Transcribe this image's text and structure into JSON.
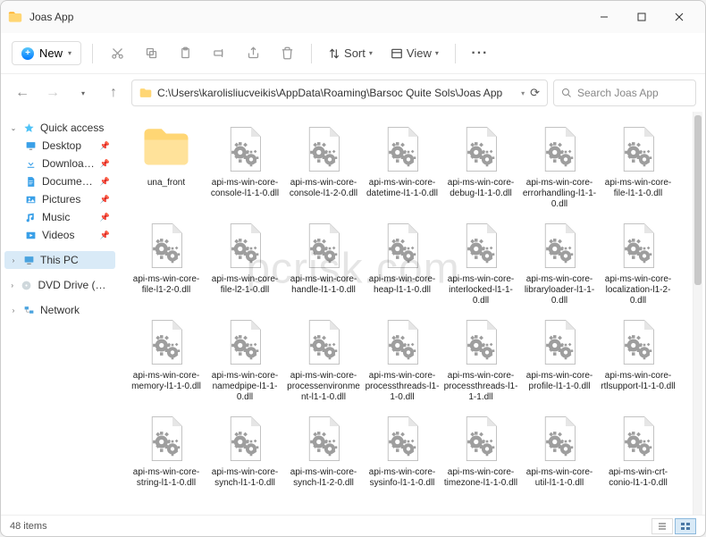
{
  "title": "Joas App",
  "toolbar": {
    "new_label": "New",
    "sort_label": "Sort",
    "view_label": "View"
  },
  "address": {
    "path": "C:\\Users\\karolisliucveikis\\AppData\\Roaming\\Barsoc Quite Sols\\Joas App",
    "search_placeholder": "Search Joas App"
  },
  "sidebar": {
    "quick_access": "Quick access",
    "items": [
      {
        "label": "Desktop",
        "icon": "desktop"
      },
      {
        "label": "Downloads",
        "icon": "downloads"
      },
      {
        "label": "Documents",
        "icon": "documents"
      },
      {
        "label": "Pictures",
        "icon": "pictures"
      },
      {
        "label": "Music",
        "icon": "music"
      },
      {
        "label": "Videos",
        "icon": "videos"
      }
    ],
    "this_pc": "This PC",
    "dvd": "DVD Drive (D:) CCCC",
    "network": "Network"
  },
  "files": [
    {
      "name": "una_front",
      "type": "folder"
    },
    {
      "name": "api-ms-win-core-console-l1-1-0.dll",
      "type": "dll"
    },
    {
      "name": "api-ms-win-core-console-l1-2-0.dll",
      "type": "dll"
    },
    {
      "name": "api-ms-win-core-datetime-l1-1-0.dll",
      "type": "dll"
    },
    {
      "name": "api-ms-win-core-debug-l1-1-0.dll",
      "type": "dll"
    },
    {
      "name": "api-ms-win-core-errorhandling-l1-1-0.dll",
      "type": "dll"
    },
    {
      "name": "api-ms-win-core-file-l1-1-0.dll",
      "type": "dll"
    },
    {
      "name": "api-ms-win-core-file-l1-2-0.dll",
      "type": "dll"
    },
    {
      "name": "api-ms-win-core-file-l2-1-0.dll",
      "type": "dll"
    },
    {
      "name": "api-ms-win-core-handle-l1-1-0.dll",
      "type": "dll"
    },
    {
      "name": "api-ms-win-core-heap-l1-1-0.dll",
      "type": "dll"
    },
    {
      "name": "api-ms-win-core-interlocked-l1-1-0.dll",
      "type": "dll"
    },
    {
      "name": "api-ms-win-core-libraryloader-l1-1-0.dll",
      "type": "dll"
    },
    {
      "name": "api-ms-win-core-localization-l1-2-0.dll",
      "type": "dll"
    },
    {
      "name": "api-ms-win-core-memory-l1-1-0.dll",
      "type": "dll"
    },
    {
      "name": "api-ms-win-core-namedpipe-l1-1-0.dll",
      "type": "dll"
    },
    {
      "name": "api-ms-win-core-processenvironment-l1-1-0.dll",
      "type": "dll"
    },
    {
      "name": "api-ms-win-core-processthreads-l1-1-0.dll",
      "type": "dll"
    },
    {
      "name": "api-ms-win-core-processthreads-l1-1-1.dll",
      "type": "dll"
    },
    {
      "name": "api-ms-win-core-profile-l1-1-0.dll",
      "type": "dll"
    },
    {
      "name": "api-ms-win-core-rtlsupport-l1-1-0.dll",
      "type": "dll"
    },
    {
      "name": "api-ms-win-core-string-l1-1-0.dll",
      "type": "dll"
    },
    {
      "name": "api-ms-win-core-synch-l1-1-0.dll",
      "type": "dll"
    },
    {
      "name": "api-ms-win-core-synch-l1-2-0.dll",
      "type": "dll"
    },
    {
      "name": "api-ms-win-core-sysinfo-l1-1-0.dll",
      "type": "dll"
    },
    {
      "name": "api-ms-win-core-timezone-l1-1-0.dll",
      "type": "dll"
    },
    {
      "name": "api-ms-win-core-util-l1-1-0.dll",
      "type": "dll"
    },
    {
      "name": "api-ms-win-crt-conio-l1-1-0.dll",
      "type": "dll"
    }
  ],
  "status": {
    "count_label": "48 items"
  },
  "watermark": "pcrisk.com"
}
